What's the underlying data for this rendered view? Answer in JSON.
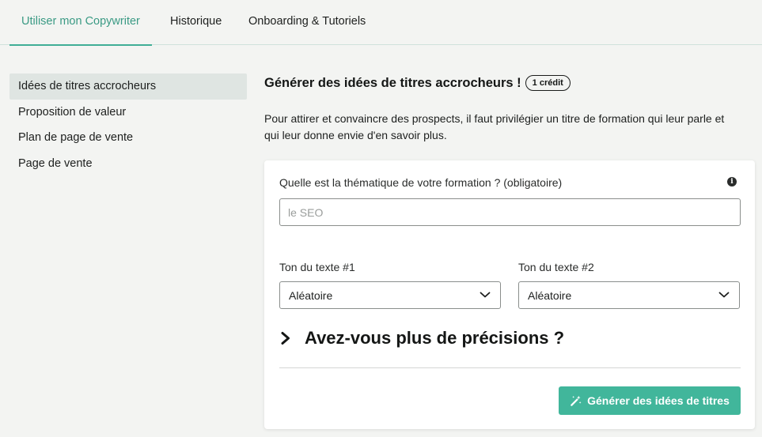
{
  "topnav": {
    "tabs": [
      {
        "label": "Utiliser mon Copywriter",
        "active": true
      },
      {
        "label": "Historique",
        "active": false
      },
      {
        "label": "Onboarding & Tutoriels",
        "active": false
      }
    ]
  },
  "sidebar": {
    "items": [
      {
        "label": "Idées de titres accrocheurs",
        "active": true
      },
      {
        "label": "Proposition de valeur",
        "active": false
      },
      {
        "label": "Plan de page de vente",
        "active": false
      },
      {
        "label": "Page de vente",
        "active": false
      }
    ]
  },
  "main": {
    "title": "Générer des idées de titres accrocheurs !",
    "credit_badge": "1 crédit",
    "description": "Pour attirer et convaincre des prospects, il faut privilégier un titre de formation qui leur parle et qui leur donne envie d'en savoir plus."
  },
  "form": {
    "theme_label": "Quelle est la thématique de votre formation ? (obligatoire)",
    "theme_value": "",
    "theme_placeholder": "le SEO",
    "info_icon": "info-icon",
    "tone1_label": "Ton du texte #1",
    "tone1_value": "Aléatoire",
    "tone2_label": "Ton du texte #2",
    "tone2_value": "Aléatoire",
    "precisions_label": "Avez-vous plus de précisions ?",
    "generate_label": "Générer des idées de titres"
  },
  "colors": {
    "accent": "#41b69b",
    "active_tab_text": "#3a9a84",
    "background": "#f3f4f2",
    "sidebar_active_bg": "#dfe5e2"
  }
}
